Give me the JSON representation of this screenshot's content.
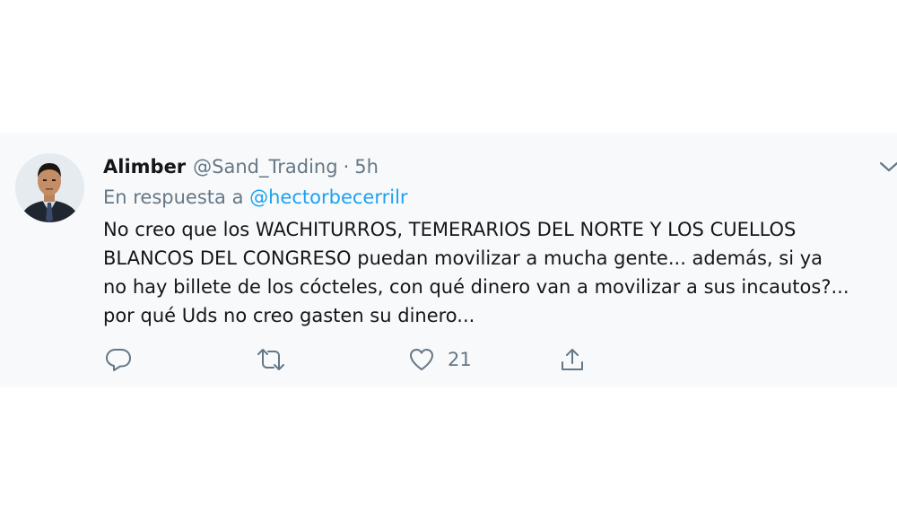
{
  "tweet": {
    "author_name": "Alimber",
    "author_handle": "@Sand_Trading",
    "separator": "·",
    "time": "5h",
    "reply_prefix": "En respuesta a",
    "reply_mention": "@hectorbecerrilr",
    "text_lines": [
      "No creo que los WACHITURROS, TEMERARIOS DEL NORTE Y LOS CUELLOS",
      "BLANCOS DEL CONGRESO puedan movilizar a mucha gente... además, si ya",
      "no hay billete de los cócteles, con qué dinero van a movilizar a sus incautos?...",
      "por qué Uds no creo gasten su dinero..."
    ],
    "actions": {
      "reply_icon": "speech-bubble-icon",
      "retweet_icon": "retweet-arrows-icon",
      "like_icon": "heart-icon",
      "like_count": "21",
      "share_icon": "share-upload-icon"
    },
    "menu_icon": "chevron-down-icon"
  },
  "colors": {
    "text_primary": "#14171a",
    "text_secondary": "#657786",
    "link": "#1da1f2",
    "tweet_background": "#f7f9fa"
  }
}
